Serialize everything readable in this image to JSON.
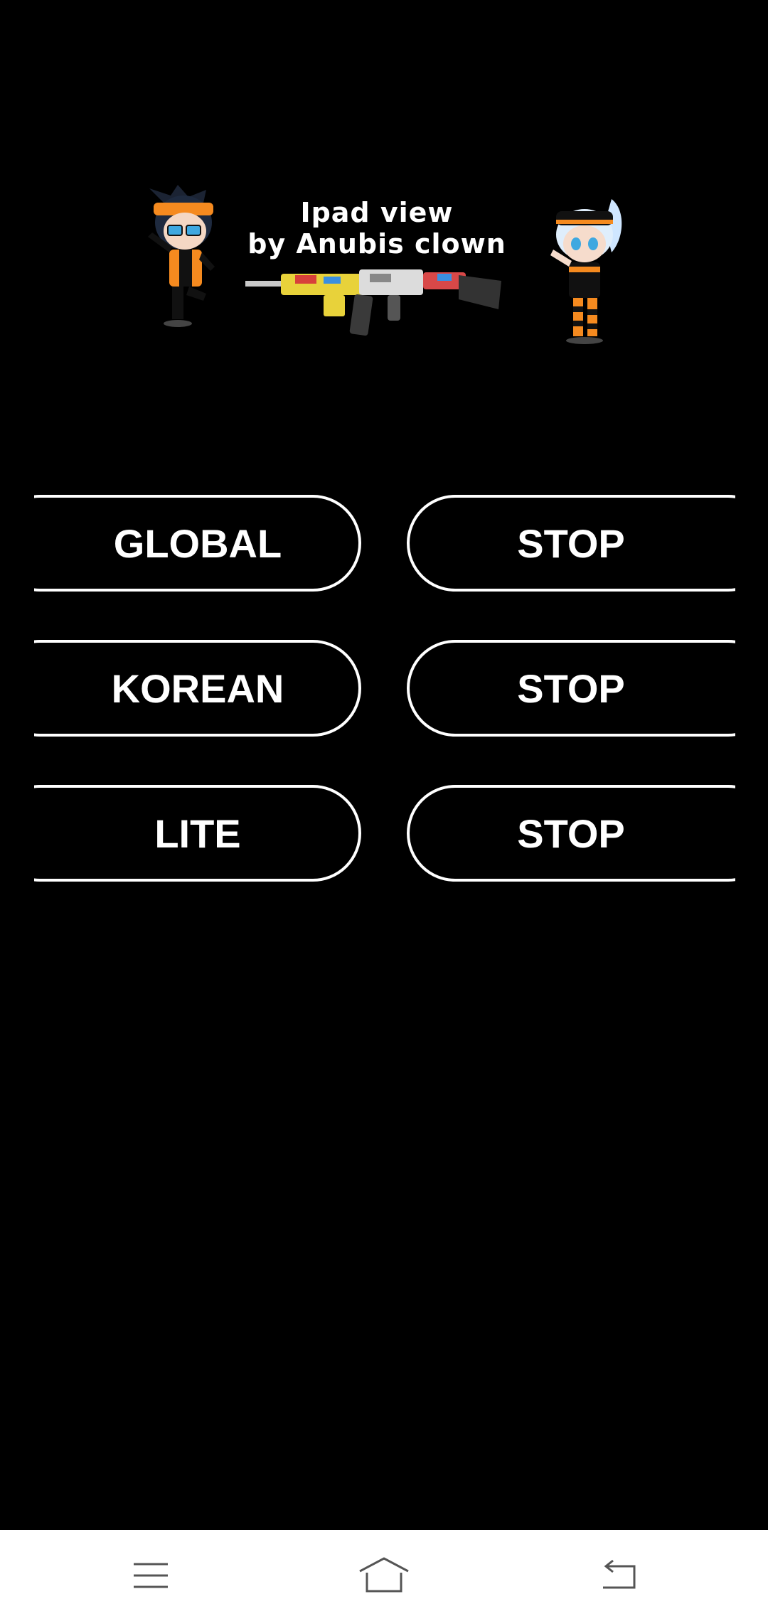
{
  "banner": {
    "title_line1": "Ipad view",
    "title_line2": "by Anubis clown"
  },
  "buttons": {
    "global_label": "GLOBAL",
    "korean_label": "KOREAN",
    "lite_label": "LITE",
    "stop_label": "STOP"
  },
  "navbar": {
    "icons": [
      "menu-icon",
      "home-icon",
      "back-icon"
    ]
  },
  "colors": {
    "background": "#000000",
    "foreground": "#ffffff",
    "accent_orange": "#f58a1f"
  }
}
